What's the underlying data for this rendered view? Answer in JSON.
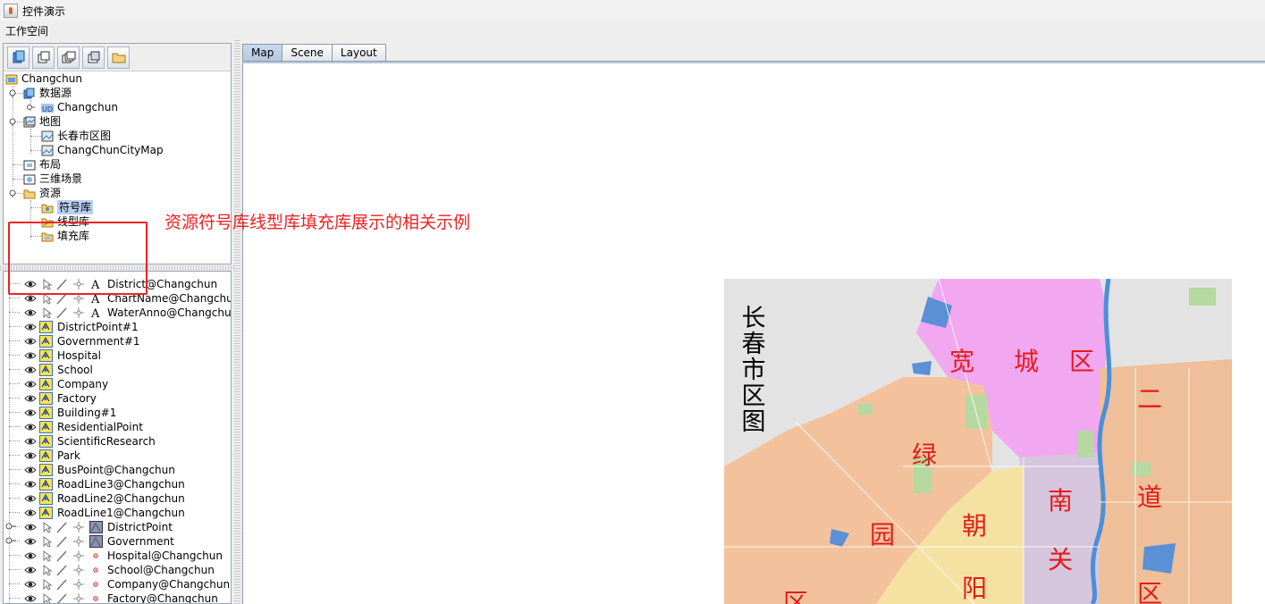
{
  "window": {
    "title": "控件演示"
  },
  "menu": {
    "workspace": "工作空间"
  },
  "workspace_tree": {
    "root": "Changchun",
    "datasources": {
      "label": "数据源",
      "items": [
        "Changchun"
      ]
    },
    "maps": {
      "label": "地图",
      "items": [
        "长春市区图",
        "ChangChunCityMap"
      ]
    },
    "layouts": {
      "label": "布局"
    },
    "scenes": {
      "label": "三维场景"
    },
    "resources": {
      "label": "资源",
      "items": [
        "符号库",
        "线型库",
        "填充库"
      ]
    }
  },
  "layers": [
    {
      "name": "District@Changchun",
      "kind": "label"
    },
    {
      "name": "ChartName@Changchun",
      "kind": "label"
    },
    {
      "name": "WaterAnno@Changchun",
      "kind": "label"
    },
    {
      "name": "DistrictPoint#1",
      "kind": "theme"
    },
    {
      "name": "Government#1",
      "kind": "theme"
    },
    {
      "name": "Hospital",
      "kind": "theme"
    },
    {
      "name": "School",
      "kind": "theme"
    },
    {
      "name": "Company",
      "kind": "theme"
    },
    {
      "name": "Factory",
      "kind": "theme"
    },
    {
      "name": "Building#1",
      "kind": "theme"
    },
    {
      "name": "ResidentialPoint",
      "kind": "theme"
    },
    {
      "name": "ScientificResearch",
      "kind": "theme"
    },
    {
      "name": "Park",
      "kind": "theme"
    },
    {
      "name": "BusPoint@Changchun",
      "kind": "theme"
    },
    {
      "name": "RoadLine3@Changchun",
      "kind": "theme"
    },
    {
      "name": "RoadLine2@Changchun",
      "kind": "theme"
    },
    {
      "name": "RoadLine1@Changchun",
      "kind": "theme"
    },
    {
      "name": "DistrictPoint",
      "kind": "group"
    },
    {
      "name": "Government",
      "kind": "group"
    },
    {
      "name": "Hospital@Changchun",
      "kind": "point"
    },
    {
      "name": "School@Changchun",
      "kind": "point"
    },
    {
      "name": "Company@Changchun",
      "kind": "point"
    },
    {
      "name": "Factory@Changchun",
      "kind": "point"
    }
  ],
  "tabs": [
    "Map",
    "Scene",
    "Layout"
  ],
  "annotation": "资源符号库线型库填充库展示的相关示例",
  "map": {
    "title": "长春市区图",
    "labels": [
      "宽",
      "城",
      "区",
      "二",
      "道",
      "区",
      "绿",
      "园",
      "区",
      "朝",
      "阳",
      "南",
      "关"
    ]
  },
  "colors": {
    "annotation": "#ee2222",
    "selection": "#b8cff2",
    "map_label": "#e31b1b"
  }
}
